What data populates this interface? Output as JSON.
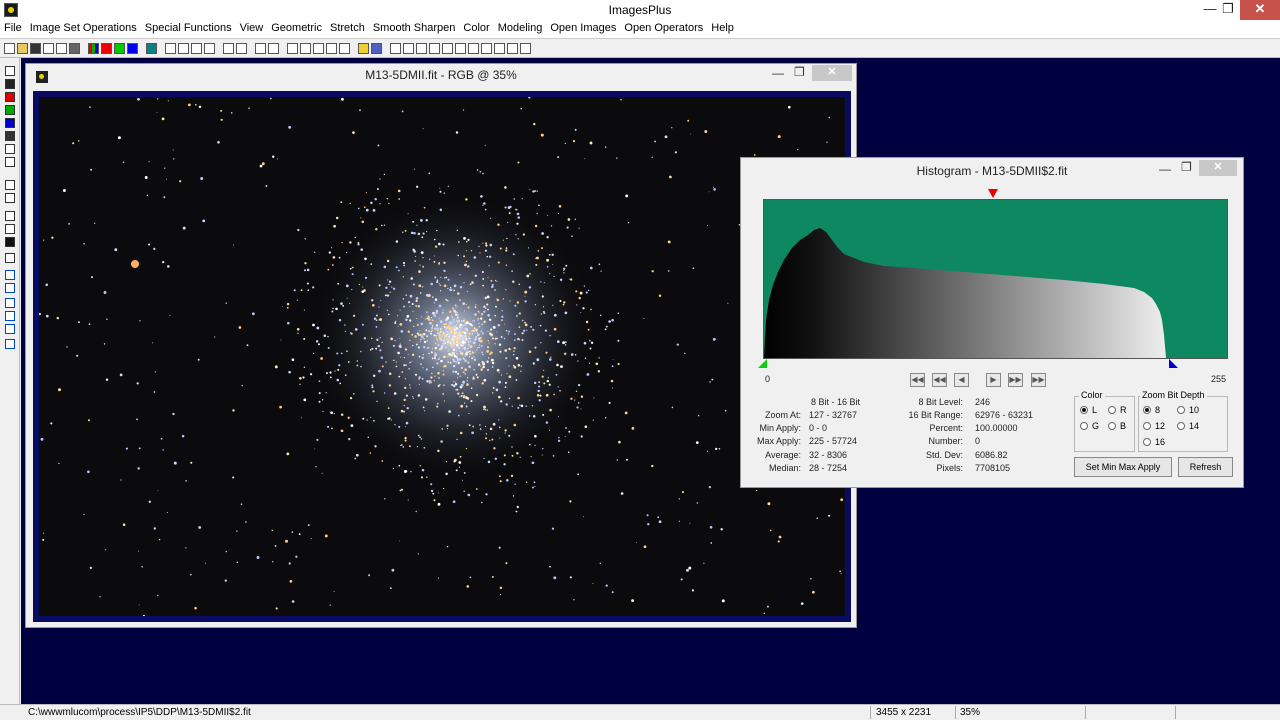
{
  "app": {
    "title": "ImagesPlus"
  },
  "menu": [
    "File",
    "Image Set Operations",
    "Special Functions",
    "View",
    "Geometric",
    "Stretch",
    "Smooth Sharpen",
    "Color",
    "Modeling",
    "Open Images",
    "Open Operators",
    "Help"
  ],
  "image_window": {
    "title": "M13-5DMII.fit - RGB @ 35%"
  },
  "histogram_window": {
    "title": "Histogram - M13-5DMII$2.fit",
    "x_min": "0",
    "x_max": "255",
    "stats_left": [
      {
        "label": "8 Bit - 16 Bit",
        "value": ""
      },
      {
        "label": "Zoom At:",
        "value": "127 - 32767"
      },
      {
        "label": "Min Apply:",
        "value": "0 - 0"
      },
      {
        "label": "Max Apply:",
        "value": "225 - 57724"
      },
      {
        "label": "Average:",
        "value": "32 - 8306"
      },
      {
        "label": "Median:",
        "value": "28 - 7254"
      }
    ],
    "stats_right": [
      {
        "label": "8 Bit Level:",
        "value": "246"
      },
      {
        "label": "16 Bit Range:",
        "value": "62976 - 63231"
      },
      {
        "label": "Percent:",
        "value": "100.00000"
      },
      {
        "label": "Number:",
        "value": "0"
      },
      {
        "label": "Std. Dev:",
        "value": "6086.82"
      },
      {
        "label": "Pixels:",
        "value": "7708105"
      }
    ],
    "color_group": {
      "label": "Color",
      "options": [
        "L",
        "R",
        "G",
        "B"
      ],
      "selected": "L"
    },
    "zoom_group": {
      "label": "Zoom Bit Depth",
      "options": [
        "8",
        "10",
        "12",
        "14",
        "16"
      ],
      "selected": "8"
    },
    "set_min_max_label": "Set Min Max Apply",
    "refresh_label": "Refresh",
    "nav_buttons": [
      "first-icon",
      "rewind-icon",
      "prev-icon",
      "next-icon",
      "fast-forward-icon",
      "last-icon"
    ]
  },
  "status": {
    "path": "C:\\wwwmlucom\\process\\IP5\\DDP\\M13-5DMII$2.fit",
    "dimensions": "3455 x 2231",
    "zoom": "35%"
  },
  "colors": {
    "workspace": "#000040",
    "histogram_bg": "#0e8860",
    "close_button": "#c7514b"
  }
}
